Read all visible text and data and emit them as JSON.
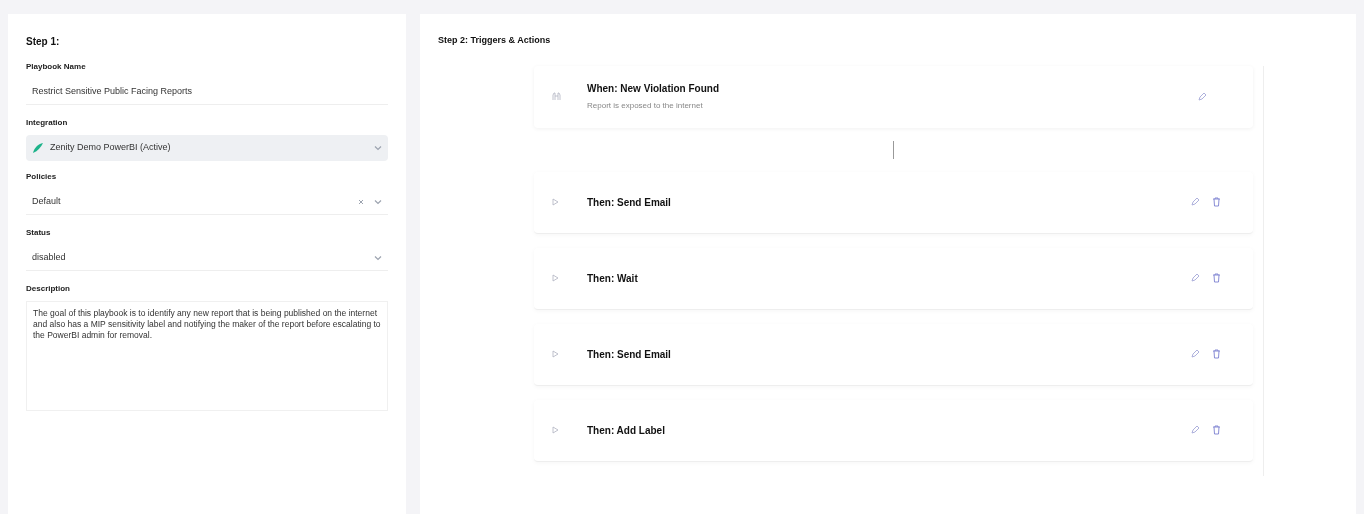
{
  "step1": {
    "title": "Step 1:",
    "fields": [
      {
        "kind": "text",
        "label": "Playbook Name",
        "value": "Restrict Sensitive Public Facing Reports"
      },
      {
        "kind": "integration",
        "label": "Integration",
        "value": "Zenity Demo PowerBI (Active)"
      },
      {
        "kind": "multiselect",
        "label": "Policies",
        "value": "Default"
      },
      {
        "kind": "select",
        "label": "Status",
        "value": "disabled"
      },
      {
        "kind": "textarea",
        "label": "Description",
        "value": "The goal of this playbook is to identify any new report that is being published on the internet and also has a MIP sensitivity label and notifying the maker of the report before escalating to the PowerBI admin for removal."
      }
    ]
  },
  "step2": {
    "title": "Step 2: Triggers & Actions",
    "steps": [
      {
        "kind": "trigger",
        "title": "When: New Violation Found",
        "subtitle": "Report is exposed to the internet"
      },
      {
        "kind": "action",
        "title": "Then: Send Email"
      },
      {
        "kind": "action",
        "title": "Then: Wait"
      },
      {
        "kind": "action",
        "title": "Then: Send Email"
      },
      {
        "kind": "action",
        "title": "Then: Add Label"
      }
    ]
  }
}
